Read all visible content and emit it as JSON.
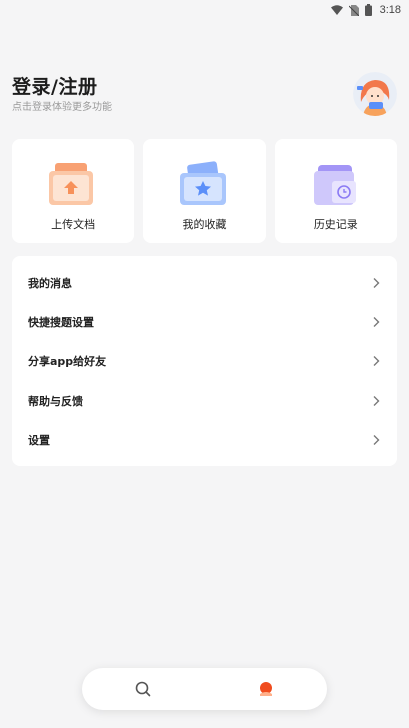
{
  "status_bar": {
    "time": "3:18",
    "icons": [
      "wifi-icon",
      "no-sim-icon",
      "battery-icon"
    ]
  },
  "header": {
    "title": "登录/注册",
    "subtitle": "点击登录体验更多功能",
    "avatar_icon": "avatar-illustration"
  },
  "quick_actions": [
    {
      "label": "上传文档",
      "icon": "upload-folder-icon",
      "color": "#f7915a"
    },
    {
      "label": "我的收藏",
      "icon": "favorites-star-icon",
      "color": "#5b8ff9"
    },
    {
      "label": "历史记录",
      "icon": "history-clock-icon",
      "color": "#8c7bf4"
    }
  ],
  "menu": [
    {
      "label": "我的消息"
    },
    {
      "label": "快捷搜题设置"
    },
    {
      "label": "分享app给好友"
    },
    {
      "label": "帮助与反馈"
    },
    {
      "label": "设置"
    }
  ],
  "bottom_nav": {
    "items": [
      {
        "icon": "search-icon"
      },
      {
        "icon": "profile-icon",
        "active": true,
        "color": "#f04c1e"
      }
    ]
  }
}
